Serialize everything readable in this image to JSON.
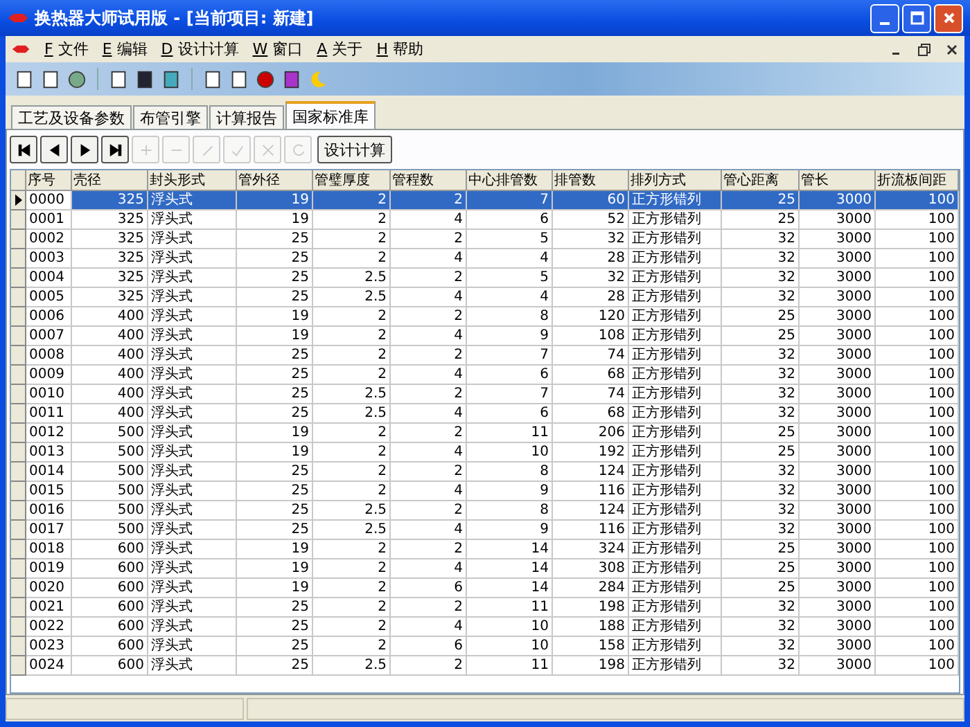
{
  "window": {
    "title": "换热器大师试用版 - [当前项目: 新建]"
  },
  "menu": [
    {
      "key": "F",
      "label": "文件"
    },
    {
      "key": "E",
      "label": "编辑"
    },
    {
      "key": "D",
      "label": "设计计算"
    },
    {
      "key": "W",
      "label": "窗口"
    },
    {
      "key": "A",
      "label": "关于"
    },
    {
      "key": "H",
      "label": "帮助"
    }
  ],
  "tabs": [
    {
      "label": "工艺及设备参数",
      "selected": false
    },
    {
      "label": "布管引擎",
      "selected": false
    },
    {
      "label": "计算报告",
      "selected": false
    },
    {
      "label": "国家标准库",
      "selected": true
    }
  ],
  "navigator": [
    {
      "kind": "first",
      "disabled": false
    },
    {
      "kind": "prior",
      "disabled": false
    },
    {
      "kind": "next",
      "disabled": false
    },
    {
      "kind": "last",
      "disabled": false
    },
    {
      "kind": "insert",
      "disabled": true
    },
    {
      "kind": "delete",
      "disabled": true
    },
    {
      "kind": "edit",
      "disabled": true
    },
    {
      "kind": "post",
      "disabled": true
    },
    {
      "kind": "cancel",
      "disabled": true
    },
    {
      "kind": "refresh",
      "disabled": true
    }
  ],
  "design_button": "设计计算",
  "table": {
    "columns": [
      {
        "label": "序号",
        "kind": "text"
      },
      {
        "label": "壳径",
        "kind": "number"
      },
      {
        "label": "封头形式",
        "kind": "text"
      },
      {
        "label": "管外径",
        "kind": "number"
      },
      {
        "label": "管璧厚度",
        "kind": "number"
      },
      {
        "label": "管程数",
        "kind": "number"
      },
      {
        "label": "中心排管数",
        "kind": "number"
      },
      {
        "label": "排管数",
        "kind": "number"
      },
      {
        "label": "排列方式",
        "kind": "text"
      },
      {
        "label": "管心距离",
        "kind": "number"
      },
      {
        "label": "管长",
        "kind": "number"
      },
      {
        "label": "折流板间距",
        "kind": "number"
      }
    ],
    "rows": [
      {
        "selected": true,
        "cells": [
          "0000",
          "325",
          "浮头式",
          "19",
          "2",
          "2",
          "7",
          "60",
          "正方形错列",
          "25",
          "3000",
          "100"
        ]
      },
      {
        "selected": false,
        "cells": [
          "0001",
          "325",
          "浮头式",
          "19",
          "2",
          "4",
          "6",
          "52",
          "正方形错列",
          "25",
          "3000",
          "100"
        ]
      },
      {
        "selected": false,
        "cells": [
          "0002",
          "325",
          "浮头式",
          "25",
          "2",
          "2",
          "5",
          "32",
          "正方形错列",
          "32",
          "3000",
          "100"
        ]
      },
      {
        "selected": false,
        "cells": [
          "0003",
          "325",
          "浮头式",
          "25",
          "2",
          "4",
          "4",
          "28",
          "正方形错列",
          "32",
          "3000",
          "100"
        ]
      },
      {
        "selected": false,
        "cells": [
          "0004",
          "325",
          "浮头式",
          "25",
          "2.5",
          "2",
          "5",
          "32",
          "正方形错列",
          "32",
          "3000",
          "100"
        ]
      },
      {
        "selected": false,
        "cells": [
          "0005",
          "325",
          "浮头式",
          "25",
          "2.5",
          "4",
          "4",
          "28",
          "正方形错列",
          "32",
          "3000",
          "100"
        ]
      },
      {
        "selected": false,
        "cells": [
          "0006",
          "400",
          "浮头式",
          "19",
          "2",
          "2",
          "8",
          "120",
          "正方形错列",
          "25",
          "3000",
          "100"
        ]
      },
      {
        "selected": false,
        "cells": [
          "0007",
          "400",
          "浮头式",
          "19",
          "2",
          "4",
          "9",
          "108",
          "正方形错列",
          "25",
          "3000",
          "100"
        ]
      },
      {
        "selected": false,
        "cells": [
          "0008",
          "400",
          "浮头式",
          "25",
          "2",
          "2",
          "7",
          "74",
          "正方形错列",
          "32",
          "3000",
          "100"
        ]
      },
      {
        "selected": false,
        "cells": [
          "0009",
          "400",
          "浮头式",
          "25",
          "2",
          "4",
          "6",
          "68",
          "正方形错列",
          "32",
          "3000",
          "100"
        ]
      },
      {
        "selected": false,
        "cells": [
          "0010",
          "400",
          "浮头式",
          "25",
          "2.5",
          "2",
          "7",
          "74",
          "正方形错列",
          "32",
          "3000",
          "100"
        ]
      },
      {
        "selected": false,
        "cells": [
          "0011",
          "400",
          "浮头式",
          "25",
          "2.5",
          "4",
          "6",
          "68",
          "正方形错列",
          "32",
          "3000",
          "100"
        ]
      },
      {
        "selected": false,
        "cells": [
          "0012",
          "500",
          "浮头式",
          "19",
          "2",
          "2",
          "11",
          "206",
          "正方形错列",
          "25",
          "3000",
          "100"
        ]
      },
      {
        "selected": false,
        "cells": [
          "0013",
          "500",
          "浮头式",
          "19",
          "2",
          "4",
          "10",
          "192",
          "正方形错列",
          "25",
          "3000",
          "100"
        ]
      },
      {
        "selected": false,
        "cells": [
          "0014",
          "500",
          "浮头式",
          "25",
          "2",
          "2",
          "8",
          "124",
          "正方形错列",
          "32",
          "3000",
          "100"
        ]
      },
      {
        "selected": false,
        "cells": [
          "0015",
          "500",
          "浮头式",
          "25",
          "2",
          "4",
          "9",
          "116",
          "正方形错列",
          "32",
          "3000",
          "100"
        ]
      },
      {
        "selected": false,
        "cells": [
          "0016",
          "500",
          "浮头式",
          "25",
          "2.5",
          "2",
          "8",
          "124",
          "正方形错列",
          "32",
          "3000",
          "100"
        ]
      },
      {
        "selected": false,
        "cells": [
          "0017",
          "500",
          "浮头式",
          "25",
          "2.5",
          "4",
          "9",
          "116",
          "正方形错列",
          "32",
          "3000",
          "100"
        ]
      },
      {
        "selected": false,
        "cells": [
          "0018",
          "600",
          "浮头式",
          "19",
          "2",
          "2",
          "14",
          "324",
          "正方形错列",
          "25",
          "3000",
          "100"
        ]
      },
      {
        "selected": false,
        "cells": [
          "0019",
          "600",
          "浮头式",
          "19",
          "2",
          "4",
          "14",
          "308",
          "正方形错列",
          "25",
          "3000",
          "100"
        ]
      },
      {
        "selected": false,
        "cells": [
          "0020",
          "600",
          "浮头式",
          "19",
          "2",
          "6",
          "14",
          "284",
          "正方形错列",
          "25",
          "3000",
          "100"
        ]
      },
      {
        "selected": false,
        "cells": [
          "0021",
          "600",
          "浮头式",
          "25",
          "2",
          "2",
          "11",
          "198",
          "正方形错列",
          "32",
          "3000",
          "100"
        ]
      },
      {
        "selected": false,
        "cells": [
          "0022",
          "600",
          "浮头式",
          "25",
          "2",
          "4",
          "10",
          "188",
          "正方形错列",
          "32",
          "3000",
          "100"
        ]
      },
      {
        "selected": false,
        "cells": [
          "0023",
          "600",
          "浮头式",
          "25",
          "2",
          "6",
          "10",
          "158",
          "正方形错列",
          "32",
          "3000",
          "100"
        ]
      },
      {
        "selected": false,
        "cells": [
          "0024",
          "600",
          "浮头式",
          "25",
          "2.5",
          "2",
          "11",
          "198",
          "正方形错列",
          "32",
          "3000",
          "100"
        ]
      }
    ]
  }
}
